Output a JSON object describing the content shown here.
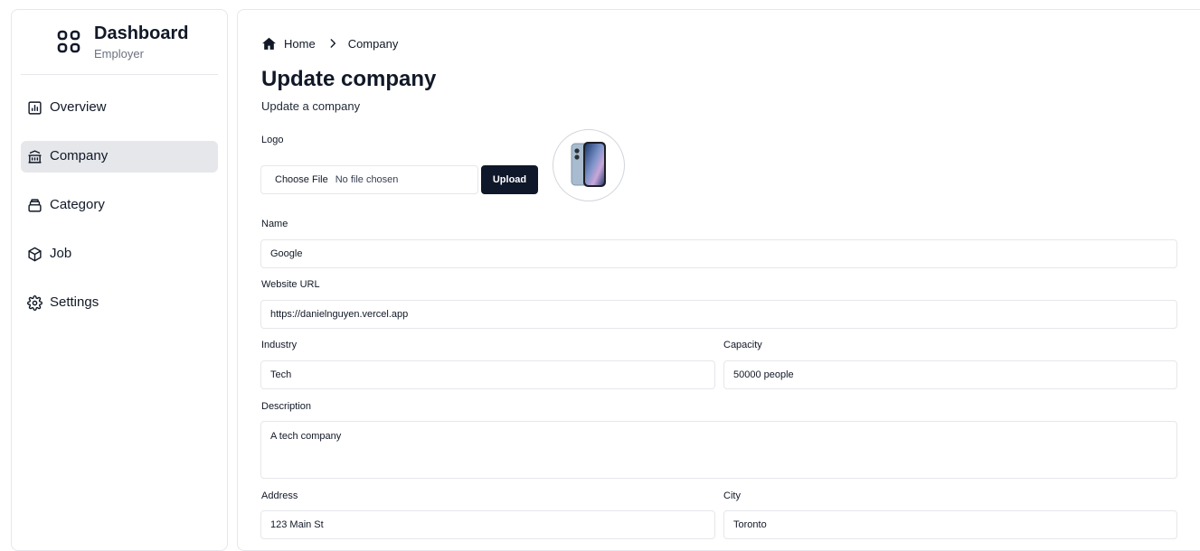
{
  "sidebar": {
    "brand_title": "Dashboard",
    "brand_subtitle": "Employer",
    "items": [
      {
        "label": "Overview",
        "icon": "bar-chart-icon",
        "active": false
      },
      {
        "label": "Company",
        "icon": "building-icon",
        "active": true
      },
      {
        "label": "Category",
        "icon": "layers-icon",
        "active": false
      },
      {
        "label": "Job",
        "icon": "cube-icon",
        "active": false
      },
      {
        "label": "Settings",
        "icon": "gear-icon",
        "active": false
      }
    ]
  },
  "breadcrumb": {
    "home": "Home",
    "current": "Company"
  },
  "page": {
    "title": "Update company",
    "subtitle": "Update a company"
  },
  "form": {
    "logo_label": "Logo",
    "file_button": "Choose File",
    "file_status": "No file chosen",
    "upload_button": "Upload",
    "name_label": "Name",
    "name_value": "Google",
    "website_label": "Website URL",
    "website_value": "https://danielnguyen.vercel.app",
    "industry_label": "Industry",
    "industry_value": "Tech",
    "capacity_label": "Capacity",
    "capacity_value": "50000 people",
    "description_label": "Description",
    "description_value": "A tech company",
    "address_label": "Address",
    "address_value": "123 Main St",
    "city_label": "City",
    "city_value": "Toronto"
  },
  "colors": {
    "active_bg": "#e5e7eb",
    "primary_button": "#0f172a",
    "border": "#e5e7eb"
  }
}
